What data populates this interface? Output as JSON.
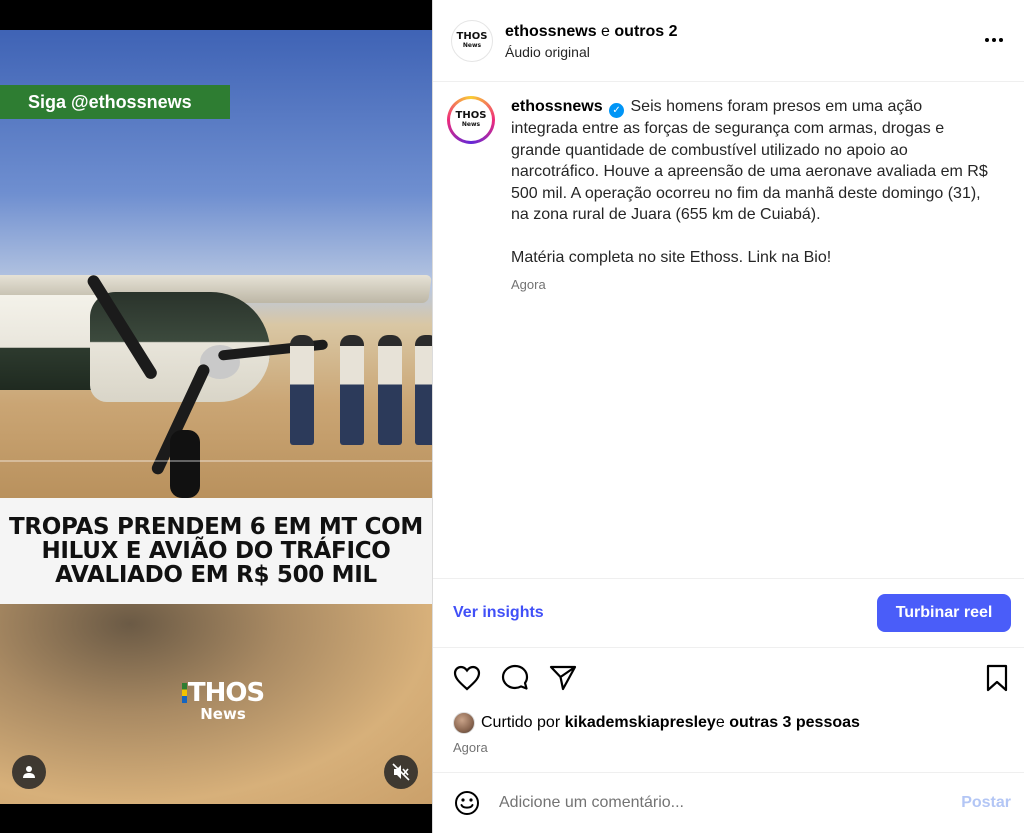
{
  "video": {
    "follow_tag": "Siga @ethossnews",
    "headline": "TROPAS PRENDEM 6 EM MT COM HILUX E AVIÃO DO TRÁFICO AVALIADO EM R$ 500 MIL",
    "brand_main": "THOS",
    "brand_sub": "News",
    "user_icon": "person-icon",
    "mute_icon": "speaker-muted-icon"
  },
  "header": {
    "username": "ethossnews",
    "joiner": " e ",
    "others": "outros 2",
    "audio": "Áudio original",
    "avatar_logo": "THOS",
    "avatar_logo_sub": "News"
  },
  "caption": {
    "username": "ethossnews",
    "verified_icon": "verified-badge-icon",
    "text": "Seis homens foram presos em uma ação integrada entre as forças de segurança com armas, drogas e grande quantidade de combustível utilizado no apoio ao narcotráfico. Houve a apreensão de uma aeronave avaliada em R$ 500 mil. A operação ocorreu no fim da manhã deste domingo (31), na zona rural de Juara (655 km de Cuiabá).",
    "text2": "Matéria completa no site Ethoss. Link na Bio!",
    "time": "Agora",
    "avatar_logo": "THOS",
    "avatar_logo_sub": "News"
  },
  "insights": {
    "link": "Ver insights",
    "boost": "Turbinar reel"
  },
  "likes": {
    "prefix": "Curtido por ",
    "user": "kikademskiapresley",
    "joiner": " e ",
    "others": "outras 3 pessoas",
    "time": "Agora"
  },
  "comment": {
    "placeholder": "Adicione um comentário...",
    "post": "Postar"
  },
  "colors": {
    "accent": "#4a5df9",
    "link": "#4150f7",
    "follow_tag": "#2e7d32",
    "verified": "#0095f6"
  }
}
